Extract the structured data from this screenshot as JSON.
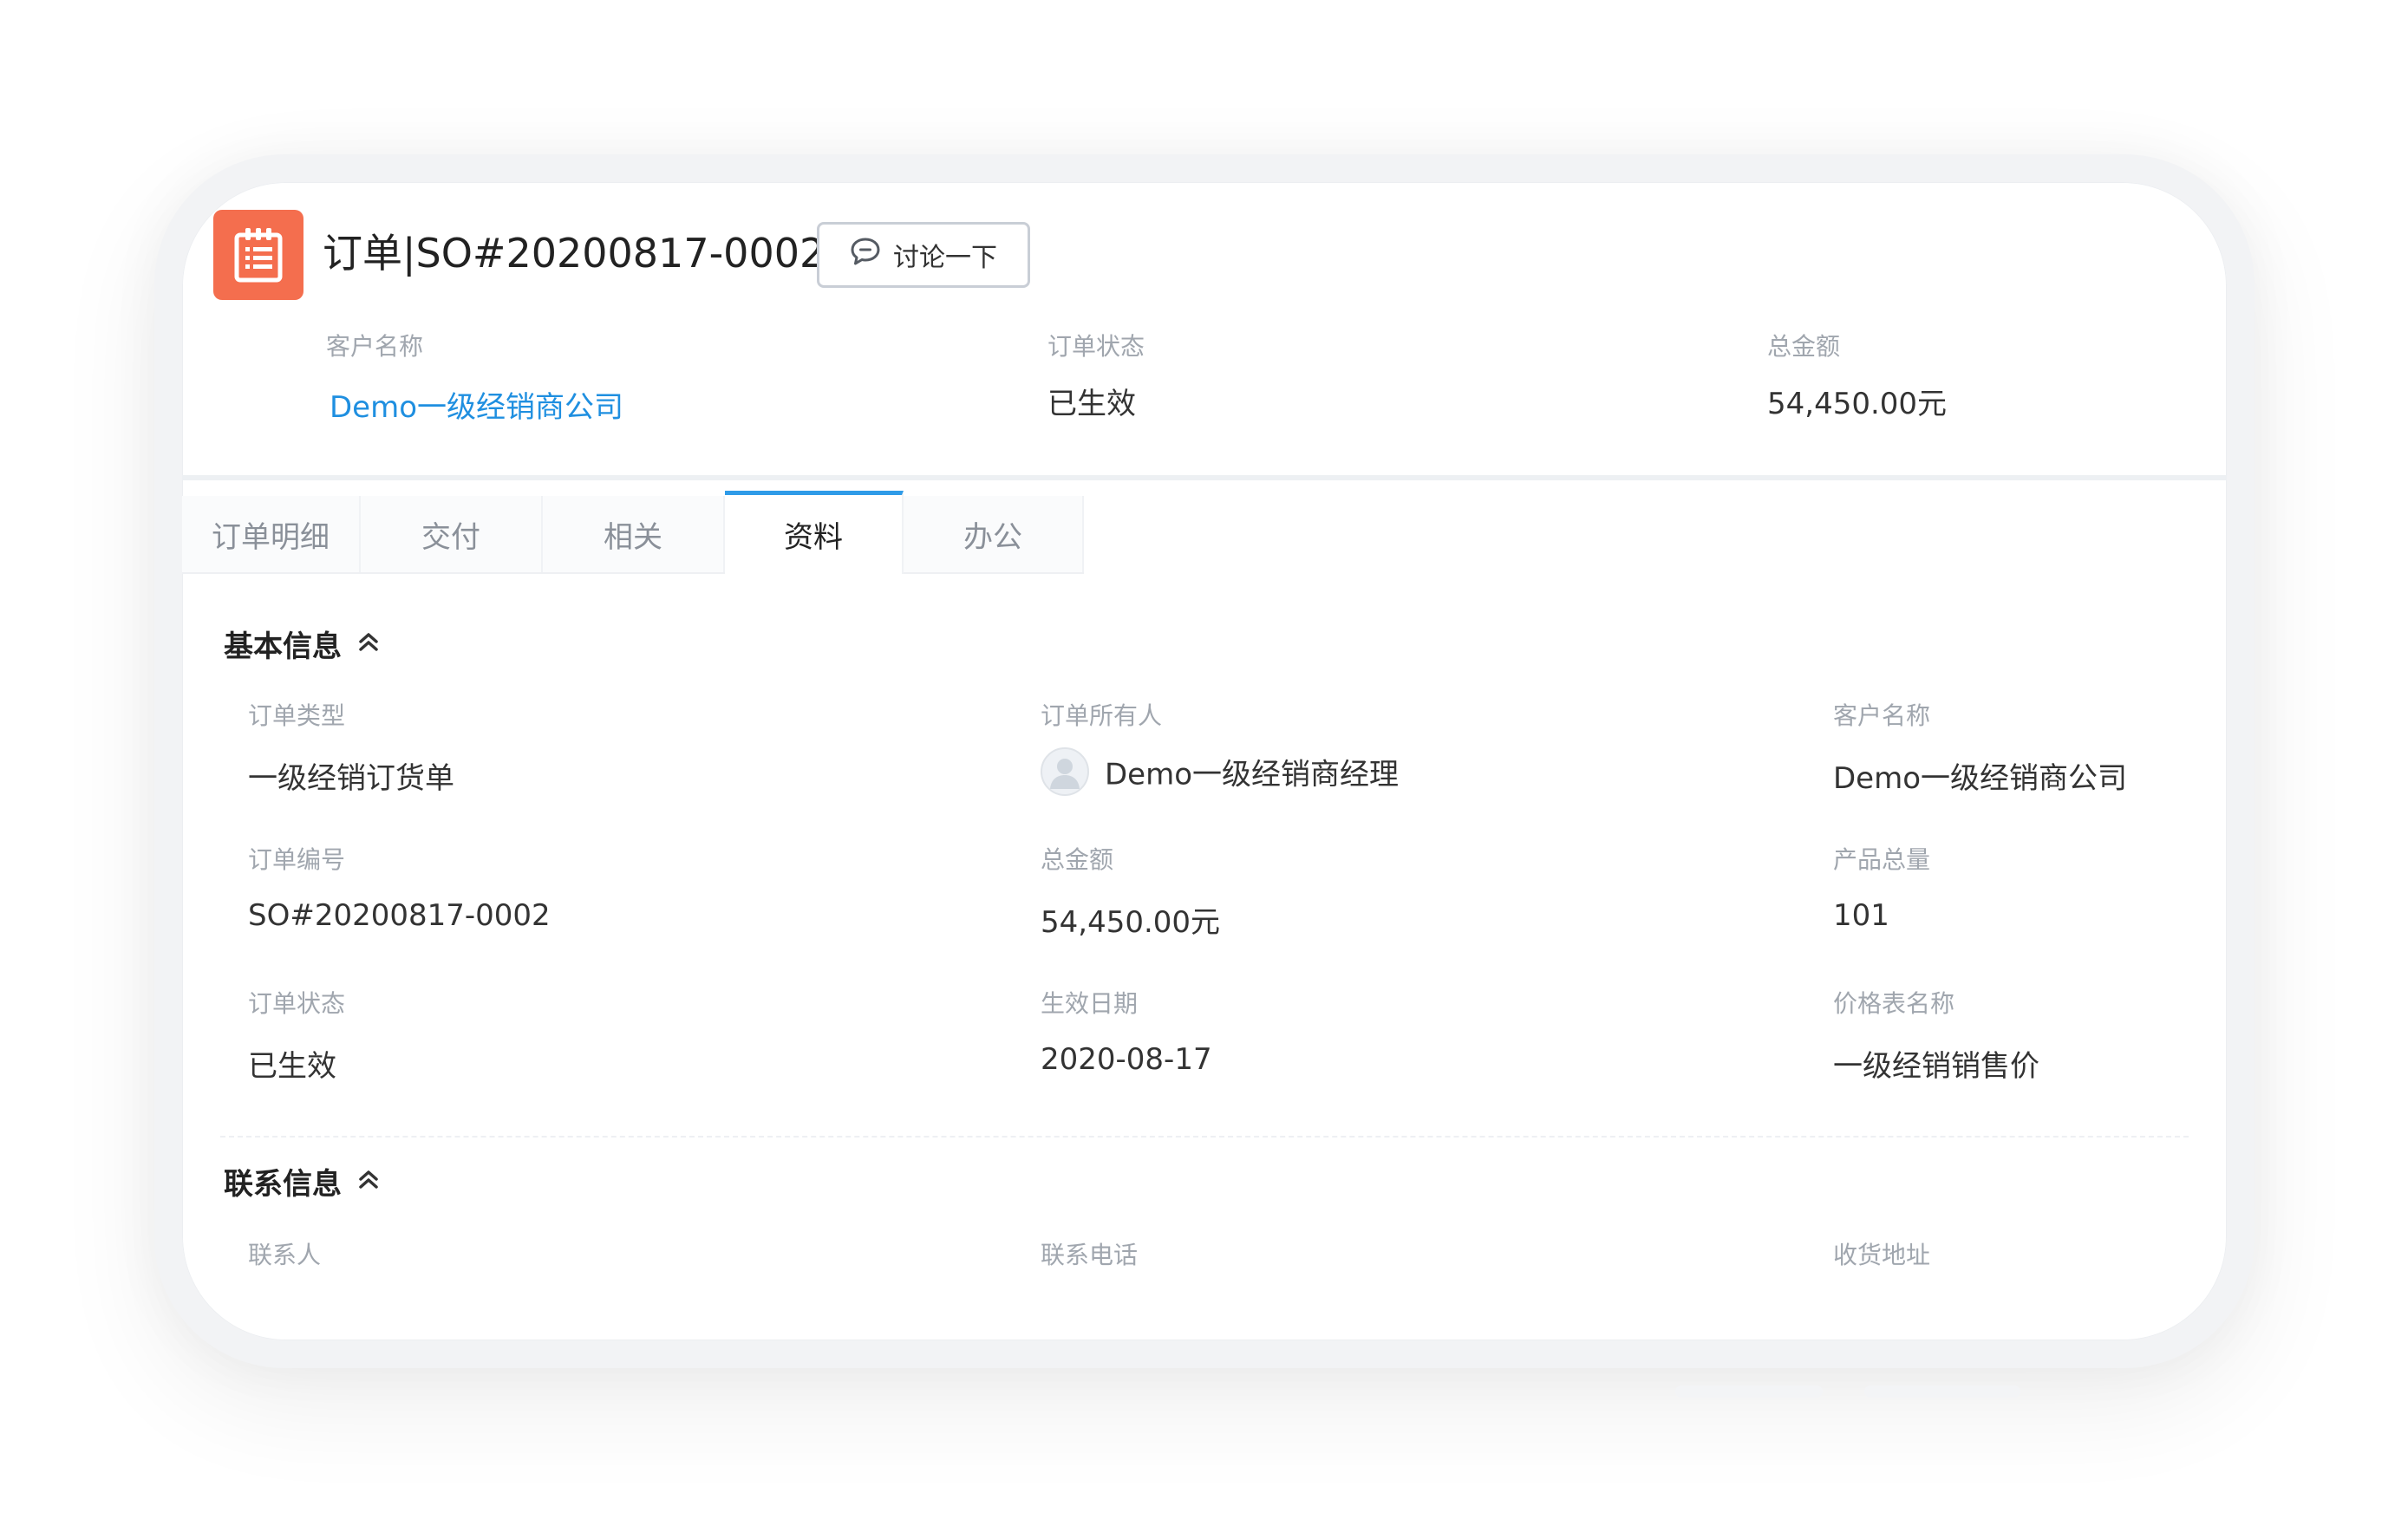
{
  "header": {
    "title": "订单|SO#20200817-0002",
    "discuss_label": "讨论一下",
    "summary": [
      {
        "label": "客户名称",
        "value": "Demo一级经销商公司",
        "is_link": true
      },
      {
        "label": "订单状态",
        "value": "已生效",
        "is_link": false
      },
      {
        "label": "总金额",
        "value": "54,450.00元",
        "is_link": false
      }
    ]
  },
  "tabs": [
    {
      "label": "订单明细",
      "active": false
    },
    {
      "label": "交付",
      "active": false
    },
    {
      "label": "相关",
      "active": false
    },
    {
      "label": "资料",
      "active": true
    },
    {
      "label": "办公",
      "active": false
    }
  ],
  "basic_info": {
    "title": "基本信息",
    "fields": [
      {
        "label": "订单类型",
        "value": "一级经销订货单"
      },
      {
        "label": "订单所有人",
        "value": "Demo一级经销商经理"
      },
      {
        "label": "客户名称",
        "value": "Demo一级经销商公司"
      },
      {
        "label": "订单编号",
        "value": "SO#20200817-0002"
      },
      {
        "label": "总金额",
        "value": "54,450.00元"
      },
      {
        "label": "产品总量",
        "value": "101"
      },
      {
        "label": "订单状态",
        "value": "已生效"
      },
      {
        "label": "生效日期",
        "value": "2020-08-17"
      },
      {
        "label": "价格表名称",
        "value": "一级经销销售价"
      }
    ]
  },
  "contact_info": {
    "title": "联系信息",
    "fields": [
      {
        "label": "联系人"
      },
      {
        "label": "联系电话"
      },
      {
        "label": "收货地址"
      }
    ]
  },
  "colors": {
    "accent": "#2f9be8",
    "link": "#1f8fe0",
    "app_icon": "#f46e4e",
    "label": "#a0a6ae"
  },
  "icons": {
    "app": "order-list-icon",
    "discuss": "chat-bubble-icon",
    "collapse": "double-chevron-up-icon",
    "owner": "avatar-icon"
  }
}
